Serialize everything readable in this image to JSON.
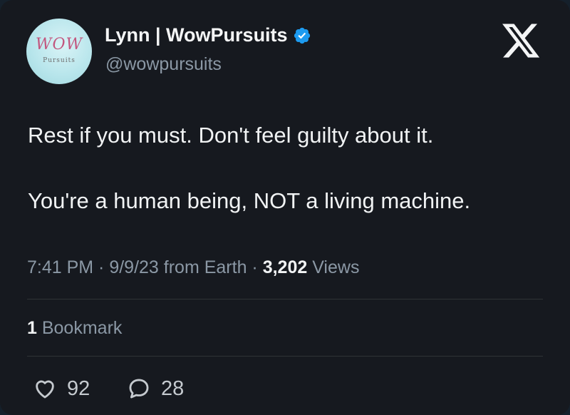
{
  "profile": {
    "display_name": "Lynn | WowPursuits",
    "handle": "@wowpursuits",
    "avatar_logo_text": "WOW",
    "avatar_logo_subtext": "Pursuits",
    "verified": true
  },
  "tweet": {
    "lines": [
      "Rest if you must. Don't feel guilty about it.",
      "You're a human being, NOT a living machine."
    ],
    "meta_prefix": "7:41 PM · 9/9/23 from Earth · ",
    "views_count": "3,202",
    "views_label": " Views"
  },
  "bookmarks": {
    "count": "1",
    "label": " Bookmark"
  },
  "actions": {
    "likes": "92",
    "replies": "28"
  },
  "colors": {
    "background": "#16191f",
    "verified_badge": "#1d9bf0",
    "muted_text": "#8b98a5"
  },
  "icons": [
    "x-logo-icon",
    "verified-badge-icon",
    "heart-icon",
    "reply-bubble-icon"
  ]
}
